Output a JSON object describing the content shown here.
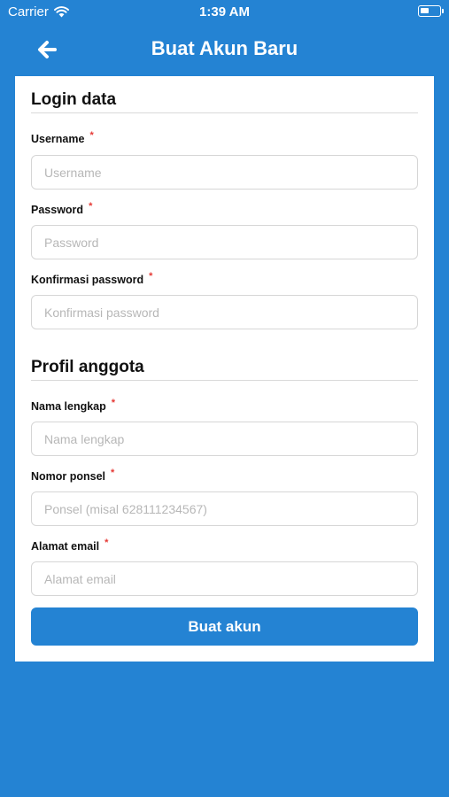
{
  "status_bar": {
    "carrier": "Carrier",
    "time": "1:39 AM",
    "wifi_icon": "wifi-icon",
    "battery_icon": "battery-icon"
  },
  "header": {
    "back_icon": "arrow-left-icon",
    "title": "Buat Akun Baru"
  },
  "login_section": {
    "title": "Login data",
    "fields": [
      {
        "label": "Username",
        "required_mark": "*",
        "placeholder": "Username",
        "value": ""
      },
      {
        "label": "Password",
        "required_mark": "*",
        "placeholder": "Password",
        "value": ""
      },
      {
        "label": "Konfirmasi password",
        "required_mark": "*",
        "placeholder": "Konfirmasi password",
        "value": ""
      }
    ]
  },
  "profile_section": {
    "title": "Profil anggota",
    "fields": [
      {
        "label": "Nama lengkap",
        "required_mark": "*",
        "placeholder": "Nama lengkap",
        "value": ""
      },
      {
        "label": "Nomor ponsel",
        "required_mark": "*",
        "placeholder": "Ponsel (misal 628111234567)",
        "value": ""
      },
      {
        "label": "Alamat email",
        "required_mark": "*",
        "placeholder": "Alamat email",
        "value": ""
      }
    ]
  },
  "submit": {
    "label": "Buat akun"
  },
  "colors": {
    "brand": "#2483D3",
    "required": "#E53935",
    "card": "#FFFFFF"
  }
}
